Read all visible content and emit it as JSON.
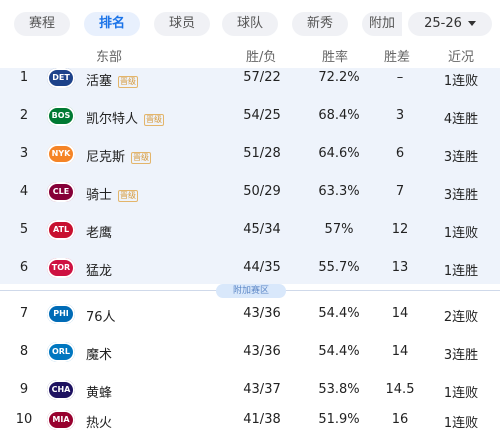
{
  "tabs": [
    "赛程",
    "排名",
    "球员",
    "球队",
    "新秀",
    "附加"
  ],
  "season": "25-26",
  "header": {
    "conference": "东部",
    "wl": "胜/负",
    "pct": "胜率",
    "gb": "胜差",
    "streak": "近况"
  },
  "playin_label": "附加赛区",
  "rows": [
    {
      "rank": "1",
      "abbr": "DET",
      "team": "活塞",
      "badge": "晋级",
      "wl": "57/22",
      "pct": "72.2%",
      "gb": "–",
      "streak": "1连败"
    },
    {
      "rank": "2",
      "abbr": "BOS",
      "team": "凯尔特人",
      "badge": "晋级",
      "wl": "54/25",
      "pct": "68.4%",
      "gb": "3",
      "streak": "4连胜"
    },
    {
      "rank": "3",
      "abbr": "NYK",
      "team": "尼克斯",
      "badge": "晋级",
      "wl": "51/28",
      "pct": "64.6%",
      "gb": "6",
      "streak": "3连胜"
    },
    {
      "rank": "4",
      "abbr": "CLE",
      "team": "骑士",
      "badge": "晋级",
      "wl": "50/29",
      "pct": "63.3%",
      "gb": "7",
      "streak": "3连胜"
    },
    {
      "rank": "5",
      "abbr": "ATL",
      "team": "老鹰",
      "badge": "",
      "wl": "45/34",
      "pct": "57%",
      "gb": "12",
      "streak": "1连败"
    },
    {
      "rank": "6",
      "abbr": "TOR",
      "team": "猛龙",
      "badge": "",
      "wl": "44/35",
      "pct": "55.7%",
      "gb": "13",
      "streak": "1连胜"
    },
    {
      "rank": "7",
      "abbr": "PHI",
      "team": "76人",
      "badge": "",
      "wl": "43/36",
      "pct": "54.4%",
      "gb": "14",
      "streak": "2连败"
    },
    {
      "rank": "8",
      "abbr": "ORL",
      "team": "魔术",
      "badge": "",
      "wl": "43/36",
      "pct": "54.4%",
      "gb": "14",
      "streak": "3连胜"
    },
    {
      "rank": "9",
      "abbr": "CHA",
      "team": "黄蜂",
      "badge": "",
      "wl": "43/37",
      "pct": "53.8%",
      "gb": "14.5",
      "streak": "1连败"
    },
    {
      "rank": "10",
      "abbr": "MIA",
      "team": "热火",
      "badge": "",
      "wl": "41/38",
      "pct": "51.9%",
      "gb": "16",
      "streak": "1连败"
    }
  ],
  "colors": {
    "DET": "#1d428a",
    "BOS": "#007a33",
    "NYK": "#f58426",
    "CLE": "#860038",
    "ATL": "#c8102e",
    "TOR": "#ce1141",
    "PHI": "#006bb6",
    "ORL": "#0077c0",
    "CHA": "#1d1160",
    "MIA": "#98002e"
  }
}
